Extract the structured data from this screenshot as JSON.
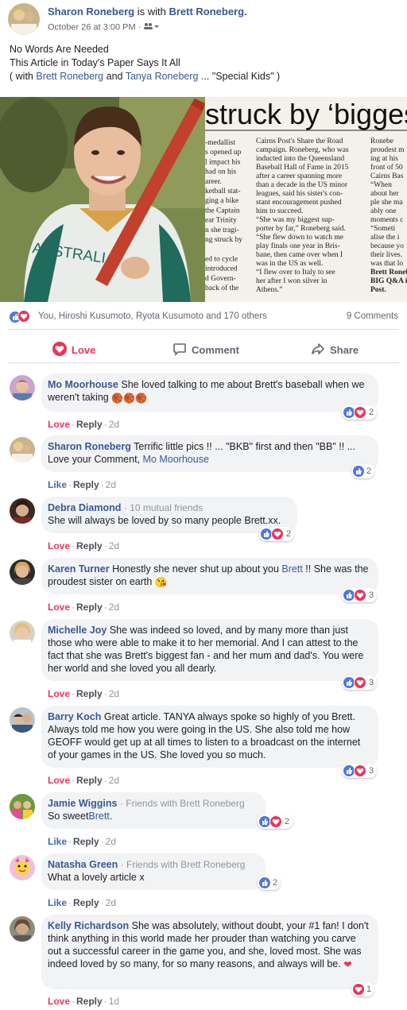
{
  "post": {
    "author": "Sharon Roneberg",
    "with_text": "is with",
    "with_name": "Brett Roneberg.",
    "date": "October 26 at 3:00 PM ·",
    "text_line1": "No Words Are Needed",
    "text_line2": "This Article in Today's Paper Says It All",
    "text_line3_open": "( with",
    "tag1": "Brett Roneberg",
    "text_and": "and",
    "tag2": "Tanya Roneberg",
    "text_line3_close": "... \"Special Kids\" )"
  },
  "article": {
    "headline": "struck by ‘biggest",
    "jersey_text": "AUSTRALIA",
    "col1": [
      "-medallist",
      "s opened up",
      "l impact his",
      "had on his",
      "areer.",
      "ketball stat-",
      "ging a bike",
      "the Captain",
      "ear Trinity",
      "n she tragi-",
      "ng struck by",
      "",
      "ed to cycle",
      "introduced",
      "d Govern-",
      "back of the"
    ],
    "col2": [
      "Cairns Post's Share the Road",
      "campaign. Roneberg, who was",
      "inducted into the Queensland",
      "Baseball Hall of Fame in 2015",
      "after a career spanning more",
      "than a decade in the US minor",
      "leagues, said his sister's con-",
      "stant encouragement pushed",
      "him to succeed.",
      "“She was my biggest sup-",
      "porter by far,” Roneberg said.",
      "“She flew down to watch me",
      "play finals one year in Bris-",
      "bane, then came over when I",
      "was in the US as well.",
      "“I flew over to Italy to see",
      "her after I won silver in",
      "Athens.”"
    ],
    "col3": [
      "Ronebe",
      "proudest m",
      "ing at his",
      "front of 50",
      "Cairns Bas",
      "“When",
      "about her",
      "ple she ma",
      "ably one",
      "moments c",
      "“Someti",
      "alise the i",
      "because yo",
      "their lives.",
      "was that lo",
      "Brett Ronebe",
      "BIG Q&A in t",
      "Post."
    ]
  },
  "reactions": {
    "names": "You, Hiroshi Kusumoto, Ryota Kusumoto and 170 others",
    "comments": "9 Comments"
  },
  "actions": {
    "love": "Love",
    "comment": "Comment",
    "share": "Share"
  },
  "comments": [
    {
      "name": "Mo Moorhouse",
      "text": "She loved talking to me about Brett's baseball when we weren't taking",
      "emoji": "🏀🏀🏀",
      "action": "Love",
      "reply": "Reply",
      "time": "2d",
      "count": "2"
    },
    {
      "name": "Sharon Roneberg",
      "text": "Terrific little pics !! ... \"BKB\" first and then \"BB\" !! ... Love your Comment,",
      "link": "Mo Moorhouse",
      "action": "Like",
      "reply": "Reply",
      "time": "2d",
      "count": "2"
    },
    {
      "name": "Debra Diamond",
      "mutual": "· 10 mutual friends",
      "text": "She will always be loved by so many people Brett.xx.",
      "action": "Love",
      "reply": "Reply",
      "time": "2d",
      "count": "2"
    },
    {
      "name": "Karen Turner",
      "text": "Honestly she never shut up about you",
      "link": "Brett",
      "text2": "!! She was the proudest sister on earth",
      "emoji": "😘",
      "action": "Love",
      "reply": "Reply",
      "time": "2d",
      "count": "3"
    },
    {
      "name": "Michelle Joy",
      "text": "She was indeed so loved, and by many more than just those who were able to make it to her memorial. And I can attest to the fact that she was Brett's biggest fan - and her mum and dad's. You were her world and she loved you all dearly.",
      "action": "Love",
      "reply": "Reply",
      "time": "2d",
      "count": "3"
    },
    {
      "name": "Barry Koch",
      "text": "Great article. TANYA always spoke so highly of you Brett. Always told me how you were going in the US. She also told me how GEOFF would get up at all times to listen to a broadcast on the internet of your games in the US. She loved you so much.",
      "action": "Love",
      "reply": "Reply",
      "time": "2d",
      "count": "3"
    },
    {
      "name": "Jamie Wiggins",
      "mutual": "· Friends with Brett Roneberg",
      "text": "So sweet",
      "link": "Brett",
      "text2": ".",
      "action": "Like",
      "reply": "Reply",
      "time": "2d",
      "count": "2"
    },
    {
      "name": "Natasha Green",
      "mutual": "· Friends with Brett Roneberg",
      "text": "What a lovely article x",
      "action": "Like",
      "reply": "Reply",
      "time": "2d",
      "count": "2"
    },
    {
      "name": "Kelly Richardson",
      "text": "She was absolutely, without doubt, your #1 fan! I don't think anything in this world made her prouder than watching you carve out a successful career in the game you, and she, loved most. She was indeed loved by so many, for so many reasons, and always will be.",
      "emoji": "❤",
      "action": "Love",
      "reply": "Reply",
      "time": "1d",
      "count": "1"
    }
  ],
  "colors": {
    "link": "#385898",
    "love": "#e9355b",
    "like": "#4267b2",
    "bubble": "#f2f3f5"
  }
}
